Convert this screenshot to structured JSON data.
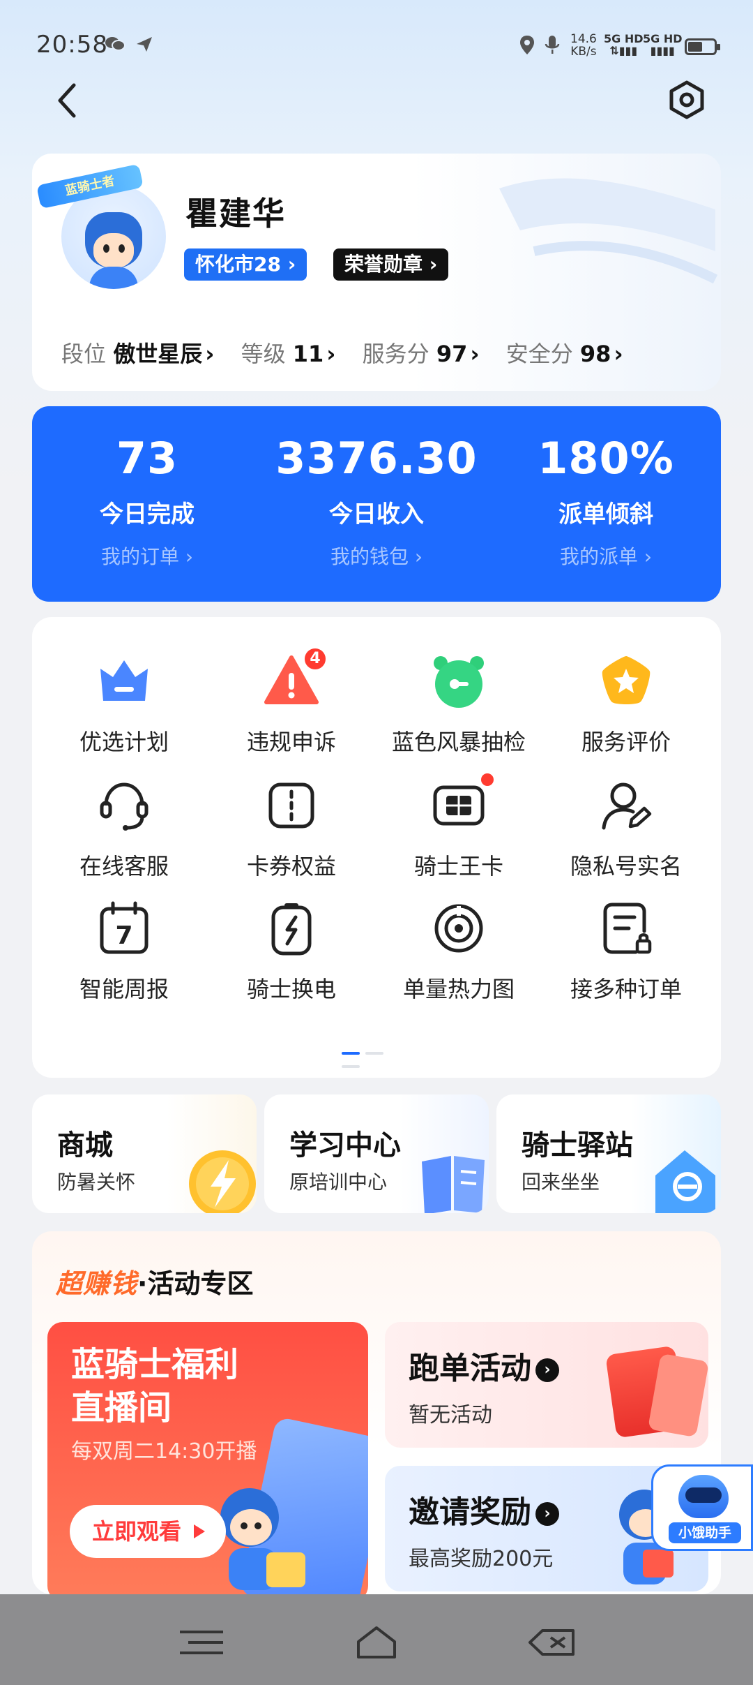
{
  "status_bar": {
    "time": "20:58",
    "net_speed_value": "14.6",
    "net_speed_unit": "KB/s",
    "sim1": "5G HD",
    "sim2": "5G HD"
  },
  "profile": {
    "avatar_tag": "蓝骑士者",
    "name": "瞿建华",
    "city_badge": "怀化市28",
    "honor_badge": "荣誉勋章",
    "stats": [
      {
        "label": "段位",
        "value": "傲世星辰"
      },
      {
        "label": "等级",
        "value": "11"
      },
      {
        "label": "服务分",
        "value": "97"
      },
      {
        "label": "安全分",
        "value": "98"
      }
    ]
  },
  "summary": [
    {
      "value": "73",
      "label": "今日完成",
      "link": "我的订单 ›"
    },
    {
      "value": "3376.30",
      "label": "今日收入",
      "link": "我的钱包 ›"
    },
    {
      "value": "180%",
      "label": "派单倾斜",
      "link": "我的派单 ›"
    }
  ],
  "grid": [
    {
      "label": "优选计划",
      "icon": "crown-icon"
    },
    {
      "label": "违规申诉",
      "icon": "warning-icon",
      "badge": "4"
    },
    {
      "label": "蓝色风暴抽检",
      "icon": "alarm-clock-icon"
    },
    {
      "label": "服务评价",
      "icon": "star-icon"
    },
    {
      "label": "在线客服",
      "icon": "headset-icon"
    },
    {
      "label": "卡券权益",
      "icon": "ticket-icon"
    },
    {
      "label": "骑士王卡",
      "icon": "sim-card-icon"
    },
    {
      "label": "隐私号实名",
      "icon": "user-edit-icon"
    },
    {
      "label": "智能周报",
      "icon": "calendar-icon",
      "calendar_day": "7"
    },
    {
      "label": "骑士换电",
      "icon": "battery-swap-icon"
    },
    {
      "label": "单量热力图",
      "icon": "target-icon"
    },
    {
      "label": "接多种订单",
      "icon": "document-icon"
    }
  ],
  "quick_cards": [
    {
      "title": "商城",
      "subtitle": "防暑关怀"
    },
    {
      "title": "学习中心",
      "subtitle": "原培训中心"
    },
    {
      "title": "骑士驿站",
      "subtitle": "回来坐坐"
    }
  ],
  "activity": {
    "brand": "超赚钱",
    "title": "·活动专区",
    "live": {
      "title_line1": "蓝骑士福利",
      "title_line2": "直播间",
      "subtitle": "每双周二14:30开播",
      "button": "立即观看"
    },
    "run": {
      "title": "跑单活动",
      "subtitle": "暂无活动"
    },
    "invite": {
      "title": "邀请奖励",
      "subtitle": "最高奖励200元"
    }
  },
  "assistant": {
    "label": "小饿助手"
  },
  "colors": {
    "primary": "#1e6bff",
    "accent_red": "#ff4f43",
    "brand_orange": "#ff6a2a"
  }
}
